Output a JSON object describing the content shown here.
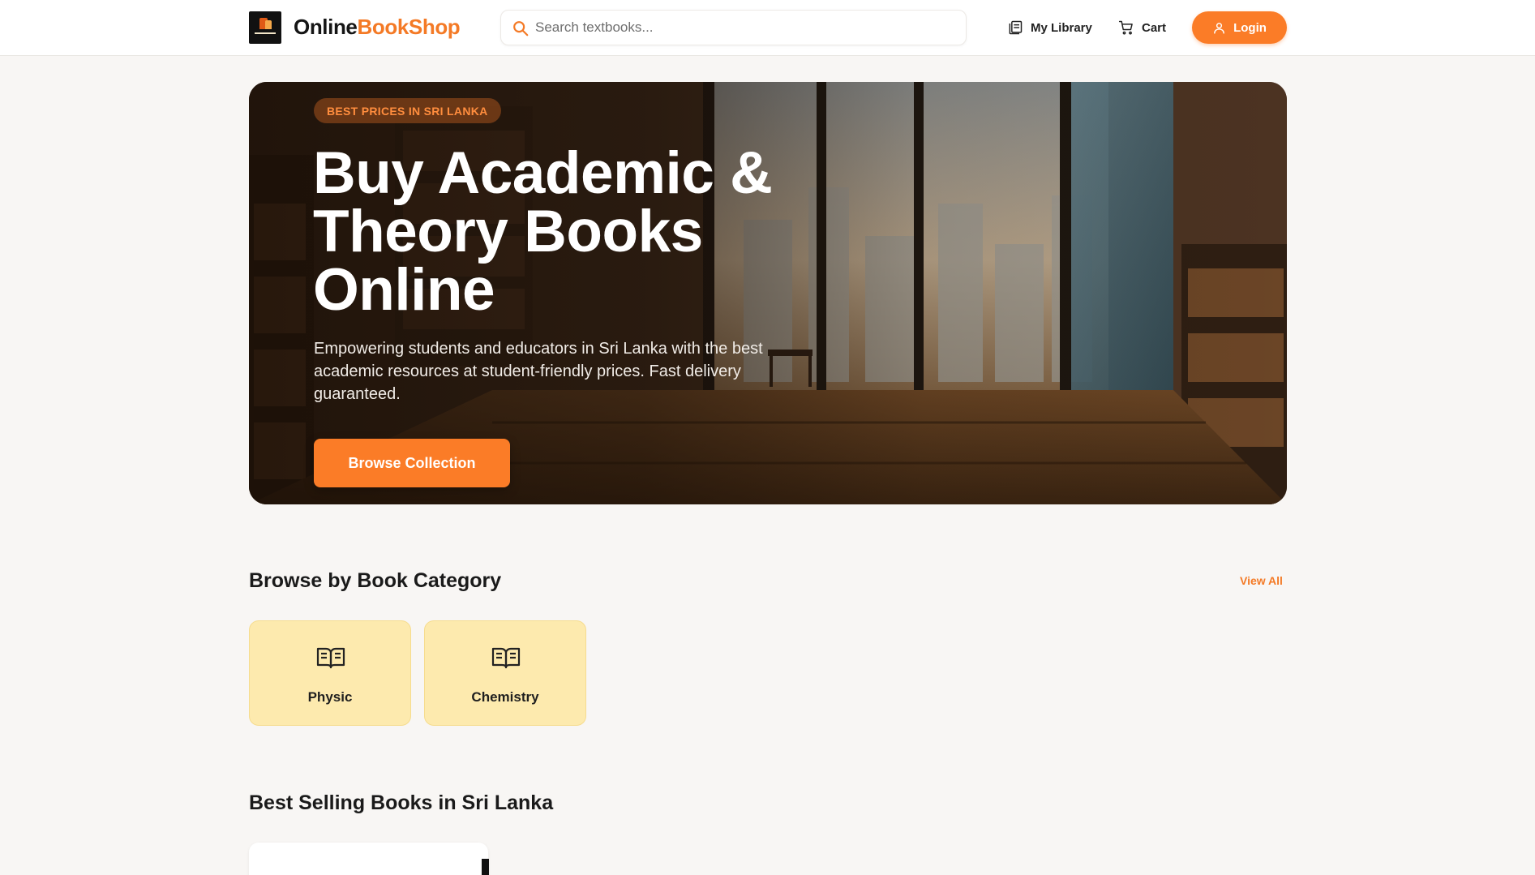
{
  "header": {
    "logo_part1": "Online",
    "logo_part2": "BookShop",
    "search_placeholder": "Search textbooks...",
    "nav": {
      "library_label": "My Library",
      "cart_label": "Cart",
      "login_label": "Login"
    }
  },
  "hero": {
    "badge": "BEST PRICES IN SRI LANKA",
    "title": "Buy Academic & Theory Books Online",
    "description": "Empowering students and educators in Sri Lanka with the best academic resources at student-friendly prices. Fast delivery guaranteed.",
    "cta_label": "Browse Collection"
  },
  "categories": {
    "title": "Browse by Book Category",
    "view_all_label": "View All",
    "items": [
      {
        "label": "Physic",
        "icon": "open-book-icon"
      },
      {
        "label": "Chemistry",
        "icon": "open-book-icon"
      }
    ]
  },
  "best_selling": {
    "title": "Best Selling Books in Sri Lanka"
  },
  "colors": {
    "accent": "#fb7c27",
    "category_card_bg": "#fdeaae",
    "page_bg": "#f8f6f4"
  }
}
